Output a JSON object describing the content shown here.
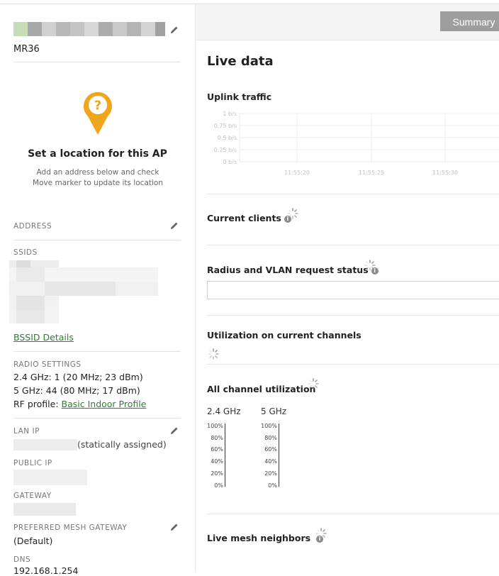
{
  "device": {
    "model": "MR36"
  },
  "location": {
    "title": "Set a location for this AP",
    "subtitle": "Add an address below and check Move marker to update its location"
  },
  "fields": {
    "address_label": "ADDRESS",
    "ssids_label": "SSIDS",
    "bssid_link": "BSSID Details",
    "radio_label": "RADIO SETTINGS",
    "radio_24": "2.4 GHz: 1 (20 MHz; 23 dBm)",
    "radio_5": "5 GHz: 44 (80 MHz; 17 dBm)",
    "rf_profile_prefix": "RF profile: ",
    "rf_profile_link": "Basic Indoor Profile",
    "lan_ip_label": "LAN IP",
    "lan_ip_suffix": "(statically assigned)",
    "public_ip_label": "PUBLIC IP",
    "gateway_label": "GATEWAY",
    "mesh_gateway_label": "PREFERRED MESH GATEWAY",
    "mesh_gateway_value": "(Default)",
    "dns_label": "DNS",
    "dns_value": "192.168.1.254"
  },
  "header": {
    "summary_button": "Summary"
  },
  "live": {
    "title": "Live data",
    "uplink_title": "Uplink traffic",
    "uplink_y_ticks": [
      "1 b/s",
      "0.75 b/s",
      "0.5 b/s",
      "0.25 b/s",
      "0 b/s"
    ],
    "uplink_x_ticks": [
      "11:55:20",
      "11:55:25",
      "11:55:30"
    ],
    "current_clients": "Current clients",
    "radius_title": "Radius and VLAN request status",
    "utilization_title": "Utilization on current channels",
    "all_channel_title": "All channel utilization",
    "band_24": "2.4 GHz",
    "band_5": "5 GHz",
    "util_ticks": [
      "100%",
      "80%",
      "60%",
      "40%",
      "20%",
      "0%"
    ],
    "mesh_title": "Live mesh neighbors"
  }
}
